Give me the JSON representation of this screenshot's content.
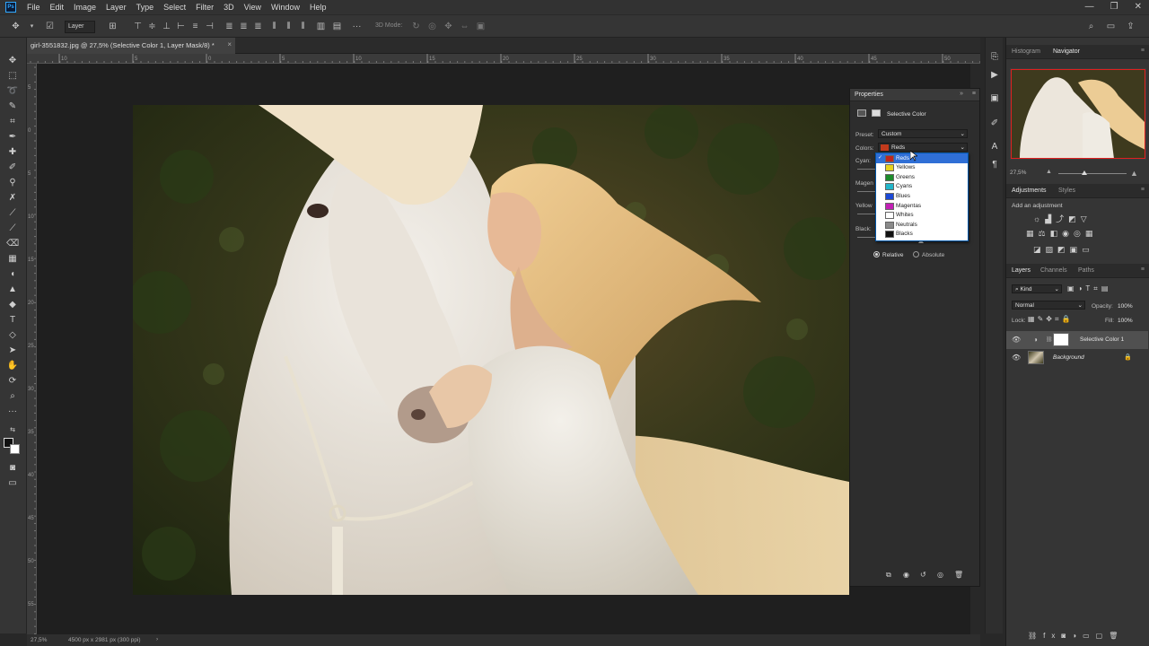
{
  "app": {
    "logo": "Ps",
    "menu": [
      "File",
      "Edit",
      "Image",
      "Layer",
      "Type",
      "Select",
      "Filter",
      "3D",
      "View",
      "Window",
      "Help"
    ],
    "window_controls": [
      "—",
      "❐",
      "✕"
    ]
  },
  "options_bar": {
    "auto_select_target": "Layer",
    "mode_3d_label": "3D Mode:"
  },
  "document": {
    "tab_title": "girl-3551832.jpg @ 27,5% (Selective Color 1, Layer Mask/8) *",
    "close_glyph": "×"
  },
  "rulers": {
    "top": [
      "10",
      "5",
      "0",
      "5",
      "10",
      "15",
      "20",
      "25",
      "30",
      "35",
      "40",
      "45",
      "50"
    ],
    "left": [
      "5",
      "0",
      "5",
      "10",
      "15",
      "20",
      "25",
      "30",
      "35",
      "40",
      "45",
      "50",
      "55"
    ]
  },
  "status_bar": {
    "zoom": "27,5%",
    "doc_info": "4500 px x 2981 px (300 ppi)",
    "arrow": "›"
  },
  "properties": {
    "panel_title": "Properties",
    "adjustment_name": "Selective Color",
    "preset_label": "Preset:",
    "preset_value": "Custom",
    "colors_label": "Colors:",
    "colors_value": "Reds",
    "colors_value_color": "#c23a1c",
    "cyan_label": "Cyan:",
    "magenta_label": "Magen",
    "yellow_label": "Yellow",
    "black_label": "Black:",
    "relative_label": "Relative",
    "absolute_label": "Absolute",
    "method_selected": "Relative"
  },
  "colors_dropdown": {
    "selected": "Reds",
    "check_glyph": "✓",
    "items": [
      {
        "label": "Reds",
        "swatch": "#c0261d"
      },
      {
        "label": "Yellows",
        "swatch": "#e6d21e"
      },
      {
        "label": "Greens",
        "swatch": "#1c8c2b"
      },
      {
        "label": "Cyans",
        "swatch": "#22b5c9"
      },
      {
        "label": "Blues",
        "swatch": "#1c49d6"
      },
      {
        "label": "Magentas",
        "swatch": "#c21fb5"
      },
      {
        "label": "Whites",
        "swatch": "#ffffff"
      },
      {
        "label": "Neutrals",
        "swatch": "#8a8a8a"
      },
      {
        "label": "Blacks",
        "swatch": "#111111"
      }
    ]
  },
  "navigator": {
    "tabs": [
      "Histogram",
      "Navigator"
    ],
    "active_tab": "Navigator",
    "zoom": "27,5%"
  },
  "adjustments": {
    "tabs": [
      "Adjustments",
      "Styles"
    ],
    "active_tab": "Adjustments",
    "add_label": "Add an adjustment"
  },
  "layers": {
    "tabs": [
      "Layers",
      "Channels",
      "Paths"
    ],
    "active_tab": "Layers",
    "filter_kind": "Kind",
    "blend_mode": "Normal",
    "opacity_label": "Opacity:",
    "opacity_value": "100%",
    "lock_label": "Lock:",
    "fill_label": "Fill:",
    "fill_value": "100%",
    "items": [
      {
        "name": "Selective Color 1",
        "visible": true,
        "selected": true
      },
      {
        "name": "Background",
        "visible": true,
        "locked": true
      }
    ],
    "footer_icons": [
      "link-icon",
      "fx-icon",
      "mask-icon",
      "adjustment-icon",
      "group-icon",
      "new-layer-icon",
      "trash-icon"
    ]
  },
  "colors": {
    "accent": "#2f6fd6",
    "panel_bg": "#353535",
    "canvas_bg": "#1f1f1f"
  }
}
